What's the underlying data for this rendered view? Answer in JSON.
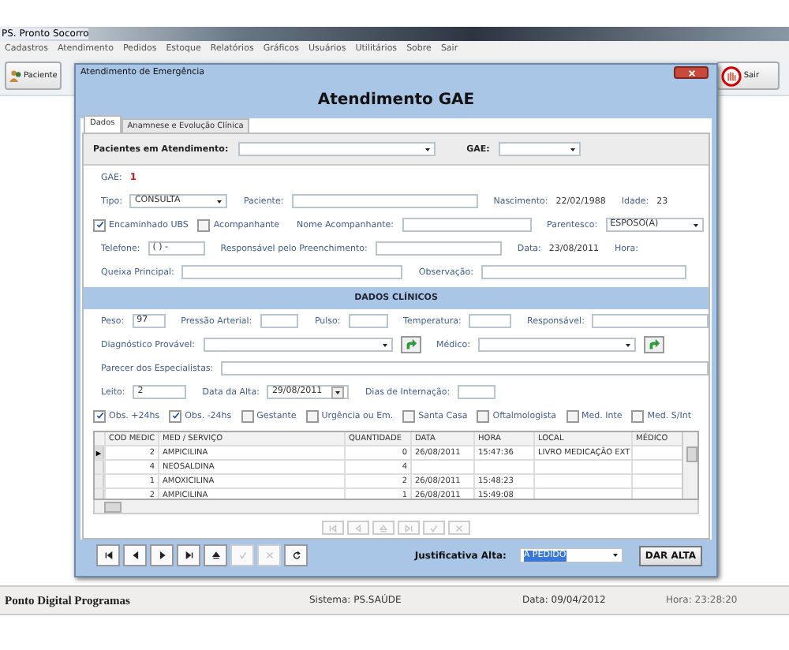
{
  "app": {
    "title": "PS. Pronto Socorro",
    "menu": [
      "Cadastros",
      "Atendimento",
      "Pedidos",
      "Estoque",
      "Relatórios",
      "Gráficos",
      "Usuários",
      "Utilitários",
      "Sobre",
      "Sair"
    ],
    "toolbar": {
      "left_button": "Paciente",
      "right_button": "Sair"
    }
  },
  "dialog": {
    "title": "Atendimento de Emergência",
    "header": "Atendimento GAE",
    "tabs": [
      {
        "label": "Dados",
        "selected": true
      },
      {
        "label": "Anamnese e Evolução Clínica",
        "selected": false
      }
    ],
    "patient_bar": {
      "patients_label": "Pacientes em Atendimento:",
      "gae_label": "GAE:"
    },
    "form_rows": [
      [
        {
          "kind": "id",
          "label": "GAE:",
          "value": "1"
        }
      ],
      [
        {
          "kind": "select",
          "label": "Tipo:",
          "value": "CONSULTA"
        },
        {
          "kind": "field",
          "label": "Paciente:"
        },
        {
          "kind": "value",
          "label": "Nascimento:",
          "value": "22/02/1988"
        },
        {
          "kind": "value",
          "label": "Idade:",
          "value": "23"
        }
      ],
      [
        {
          "kind": "check",
          "label": "Encaminhado UBS",
          "checked": true
        },
        {
          "kind": "check",
          "label": "Acompanhante",
          "checked": false
        },
        {
          "kind": "field",
          "label": "Nome Acompanhante:"
        },
        {
          "kind": "select",
          "label": "Parentesco:",
          "value": "ESPOSO(A)"
        }
      ],
      [
        {
          "kind": "field",
          "label": "Telefone:",
          "value": "( )  -"
        },
        {
          "kind": "field",
          "label": "Responsável pelo Preenchimento:"
        },
        {
          "kind": "value",
          "label": "Data:",
          "value": "23/08/2011"
        },
        {
          "kind": "text",
          "label": "Hora:"
        }
      ],
      [
        {
          "kind": "field",
          "label": "Queixa Principal:"
        },
        {
          "kind": "field",
          "label": "Observação:"
        }
      ]
    ],
    "clinical_title": "DADOS CLÍNICOS",
    "clinical_rows": [
      [
        {
          "kind": "field",
          "label": "Peso:",
          "value": "97"
        },
        {
          "kind": "field",
          "label": "Pressão Arterial:"
        },
        {
          "kind": "field",
          "label": "Pulso:"
        },
        {
          "kind": "field",
          "label": "Temperatura:"
        },
        {
          "kind": "field",
          "label": "Responsável:"
        }
      ],
      [
        {
          "kind": "select",
          "label": "Diagnóstico Provável:"
        },
        {
          "kind": "go"
        },
        {
          "kind": "select",
          "label": "Médico:"
        },
        {
          "kind": "go"
        }
      ],
      [
        {
          "kind": "field",
          "label": "Parecer dos Especialistas:"
        }
      ],
      [
        {
          "kind": "field",
          "label": "Leito:",
          "value": "2"
        },
        {
          "kind": "date",
          "label": "Data da Alta:",
          "value": "29/08/2011"
        },
        {
          "kind": "field",
          "label": "Dias de Internação:"
        }
      ],
      [
        {
          "kind": "check",
          "label": "Obs. +24hs",
          "checked": true
        },
        {
          "kind": "check",
          "label": "Obs. -24hs",
          "checked": true
        },
        {
          "kind": "check",
          "label": "Gestante",
          "checked": false
        },
        {
          "kind": "check",
          "label": "Urgência ou Em.",
          "checked": false
        },
        {
          "kind": "check",
          "label": "Santa Casa",
          "checked": false
        },
        {
          "kind": "check",
          "label": "Oftalmologista",
          "checked": false
        },
        {
          "kind": "check",
          "label": "Med. Inte",
          "checked": false
        },
        {
          "kind": "check",
          "label": "Med. S/Int",
          "checked": false
        }
      ]
    ],
    "table": {
      "columns": [
        "COD MEDIC",
        "MED / SERVIÇO",
        "QUANTIDADE",
        "DATA",
        "HORA",
        "LOCAL",
        "MÉDICO"
      ],
      "rows": [
        {
          "selected": true,
          "cells": [
            "2",
            "AMPICILINA",
            "0",
            "26/08/2011",
            "15:47:36",
            "LIVRO MEDICAÇÃO EXT",
            ""
          ]
        },
        {
          "selected": false,
          "cells": [
            "4",
            "NEOSALDINA",
            "4",
            "",
            "",
            "",
            ""
          ]
        },
        {
          "selected": false,
          "cells": [
            "1",
            "AMOXICILINA",
            "2",
            "26/08/2011",
            "15:48:23",
            "",
            ""
          ]
        },
        {
          "selected": false,
          "cells": [
            "2",
            "AMPICILINA",
            "1",
            "26/08/2011",
            "15:49:08",
            "",
            ""
          ]
        }
      ]
    },
    "grid_nav": [
      {
        "kind": "first",
        "disabled": true
      },
      {
        "kind": "prev",
        "disabled": true
      },
      {
        "kind": "up",
        "disabled": true
      },
      {
        "kind": "last",
        "disabled": true
      },
      {
        "kind": "check",
        "disabled": true
      },
      {
        "kind": "cancel",
        "disabled": true
      }
    ],
    "nav": [
      {
        "kind": "first",
        "disabled": false
      },
      {
        "kind": "prev",
        "disabled": false
      },
      {
        "kind": "next",
        "disabled": false
      },
      {
        "kind": "last",
        "disabled": false
      },
      {
        "kind": "up",
        "disabled": false
      },
      {
        "kind": "check",
        "disabled": true
      },
      {
        "kind": "cancel",
        "disabled": true
      },
      {
        "kind": "refresh",
        "disabled": false
      }
    ],
    "justification_label": "Justificativa Alta:",
    "justification_value": "A PEDIDO",
    "discharge_button": "DAR ALTA"
  },
  "status_bar": {
    "company": "Ponto Digital Programas",
    "system": "Sistema: PS.SAÚDE",
    "date": "Data: 09/04/2012",
    "time": "Hora: 23:28:20"
  }
}
